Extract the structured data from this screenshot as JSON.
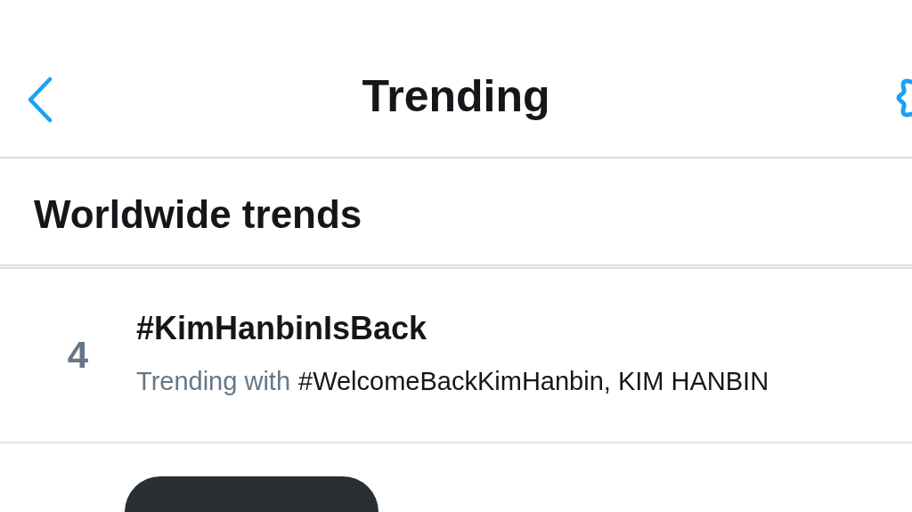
{
  "header": {
    "title": "Trending"
  },
  "section": {
    "title": "Worldwide trends"
  },
  "trends": [
    {
      "rank": "4",
      "name": "#KimHanbinIsBack",
      "context_label": "Trending with",
      "related": "#WelcomeBackKimHanbin, KIM HANBIN"
    }
  ]
}
